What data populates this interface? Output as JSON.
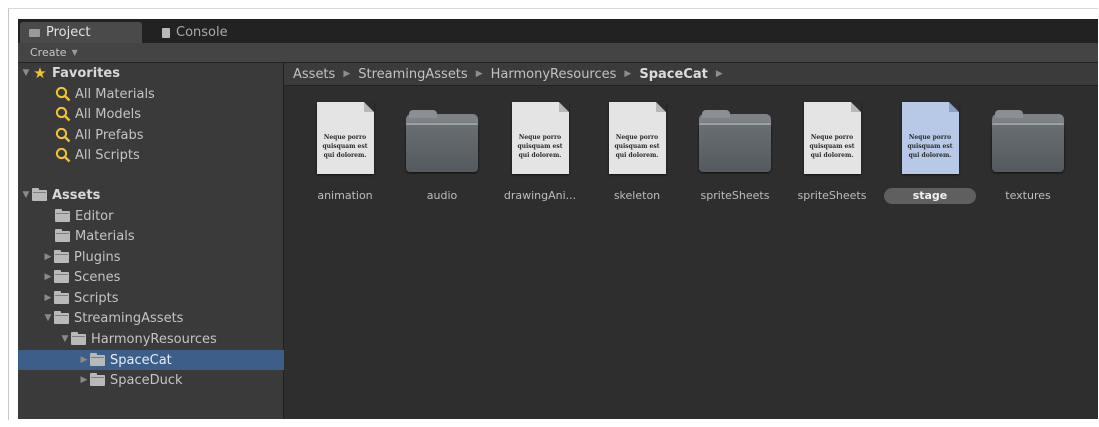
{
  "tabs": {
    "project": "Project",
    "console": "Console"
  },
  "toolbar": {
    "create_label": "Create"
  },
  "sidebar": {
    "favorites": {
      "label": "Favorites",
      "items": [
        {
          "label": "All Materials"
        },
        {
          "label": "All Models"
        },
        {
          "label": "All Prefabs"
        },
        {
          "label": "All Scripts"
        }
      ]
    },
    "assets": {
      "label": "Assets",
      "items": [
        {
          "label": "Editor"
        },
        {
          "label": "Materials"
        },
        {
          "label": "Plugins"
        },
        {
          "label": "Scenes"
        },
        {
          "label": "Scripts"
        },
        {
          "label": "StreamingAssets"
        },
        {
          "label": "HarmonyResources"
        },
        {
          "label": "SpaceCat"
        },
        {
          "label": "SpaceDuck"
        }
      ]
    }
  },
  "breadcrumb": [
    "Assets",
    "StreamingAssets",
    "HarmonyResources",
    "SpaceCat"
  ],
  "grid": {
    "doc_text": "Neque porro quisquam est qui dolorem.",
    "items": [
      {
        "label": "animation",
        "kind": "document"
      },
      {
        "label": "audio",
        "kind": "folder"
      },
      {
        "label": "drawingAni...",
        "kind": "document"
      },
      {
        "label": "skeleton",
        "kind": "document"
      },
      {
        "label": "spriteSheets",
        "kind": "folder"
      },
      {
        "label": "spriteSheets",
        "kind": "document"
      },
      {
        "label": "stage",
        "kind": "document",
        "selected": true
      },
      {
        "label": "textures",
        "kind": "folder"
      }
    ]
  },
  "colors": {
    "panel_bg": "#3a3a3a",
    "content_bg": "#2e2e2e",
    "selection": "#3d5e89",
    "favorite_star": "#f2c330",
    "search_icon": "#f2c330"
  }
}
